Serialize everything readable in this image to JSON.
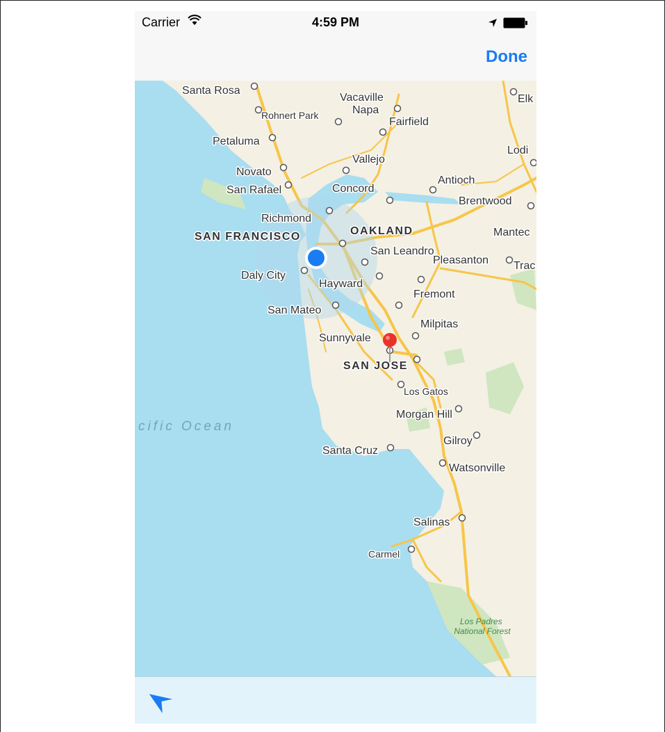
{
  "status_bar": {
    "carrier": "Carrier",
    "time": "4:59 PM",
    "icons": [
      "wifi-icon",
      "location-arrow-icon",
      "battery-icon"
    ]
  },
  "nav_bar": {
    "done_label": "Done"
  },
  "map": {
    "ocean_label": "cific Ocean",
    "region_label": "Los Padres\nNational Forest",
    "cities": [
      "Santa Rosa",
      "Vacaville",
      "Elk",
      "Rohnert Park",
      "Napa",
      "Fairfield",
      "Petaluma",
      "Lodi",
      "Vallejo",
      "Novato",
      "Antioch",
      "San Rafael",
      "Concord",
      "Brentwood",
      "Richmond",
      "OAKLAND",
      "SAN FRANCISCO",
      "Mantec",
      "San Leandro",
      "Pleasanton",
      "Trac",
      "Daly City",
      "Hayward",
      "Fremont",
      "San Mateo",
      "Milpitas",
      "Sunnyvale",
      "SAN JOSE",
      "Los Gatos",
      "Morgan Hill",
      "Gilroy",
      "Santa Cruz",
      "Watsonville",
      "Salinas",
      "Carmel"
    ],
    "colors": {
      "ocean": "#a9ddf0",
      "land": "#f4f0e4",
      "park": "#cfe6c0",
      "road": "#f7c548",
      "user_location": "#1a7cf2",
      "pin": "#e8332a"
    }
  },
  "toolbar": {
    "tracking_icon": "location-arrow-icon"
  }
}
